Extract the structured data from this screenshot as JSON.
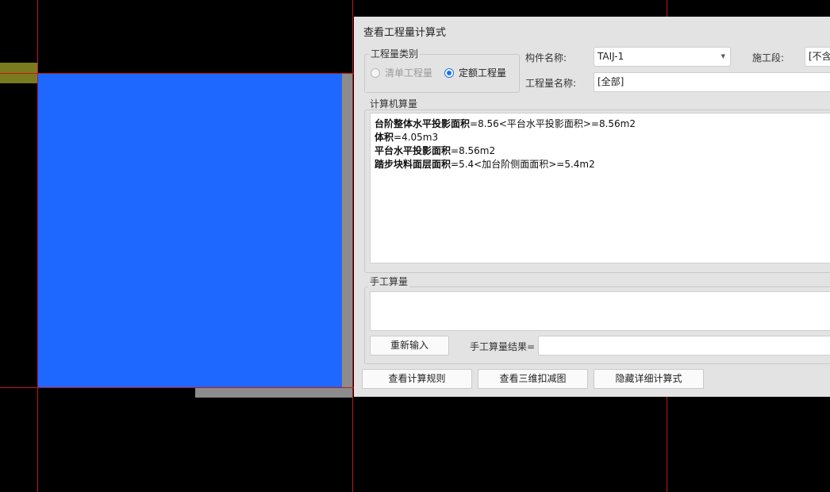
{
  "dialog": {
    "title": "查看工程量计算式",
    "quantity_type": {
      "legend": "工程量类别",
      "options": [
        {
          "label": "清单工程量",
          "selected": false,
          "enabled": false
        },
        {
          "label": "定额工程量",
          "selected": true,
          "enabled": true
        }
      ]
    },
    "component_name": {
      "label": "构件名称:",
      "value": "TAIJ-1"
    },
    "construction_section": {
      "label": "施工段:",
      "value": "[不含"
    },
    "quantity_name": {
      "label": "工程量名称:",
      "value": "[全部]"
    },
    "computer_calc": {
      "legend": "计算机算量",
      "lines": [
        {
          "name": "台阶整体水平投影面积",
          "rest": "=8.56<平台水平投影面积>=8.56m2"
        },
        {
          "name": "体积",
          "rest": "=4.05m3"
        },
        {
          "name": "平台水平投影面积",
          "rest": "=8.56m2"
        },
        {
          "name": "踏步块料面层面积",
          "rest": "=5.4<加台阶侧面面积>=5.4m2"
        }
      ]
    },
    "manual_calc": {
      "legend": "手工算量",
      "reenter_button": "重新输入",
      "result_label": "手工算量结果=",
      "result_value": ""
    },
    "buttons": {
      "view_rules": "查看计算规则",
      "view_3d": "查看三维扣减图",
      "hide_detail": "隐藏详细计算式"
    }
  },
  "colors": {
    "canvas_background": "#000000",
    "axis_line": "#c4161c",
    "slab": "#1e68ff",
    "slab_shadow": "#8c8c8c",
    "beam": "#7a7a1e",
    "dialog_background": "#e3e3e3",
    "radio_accent": "#1a73e8"
  }
}
